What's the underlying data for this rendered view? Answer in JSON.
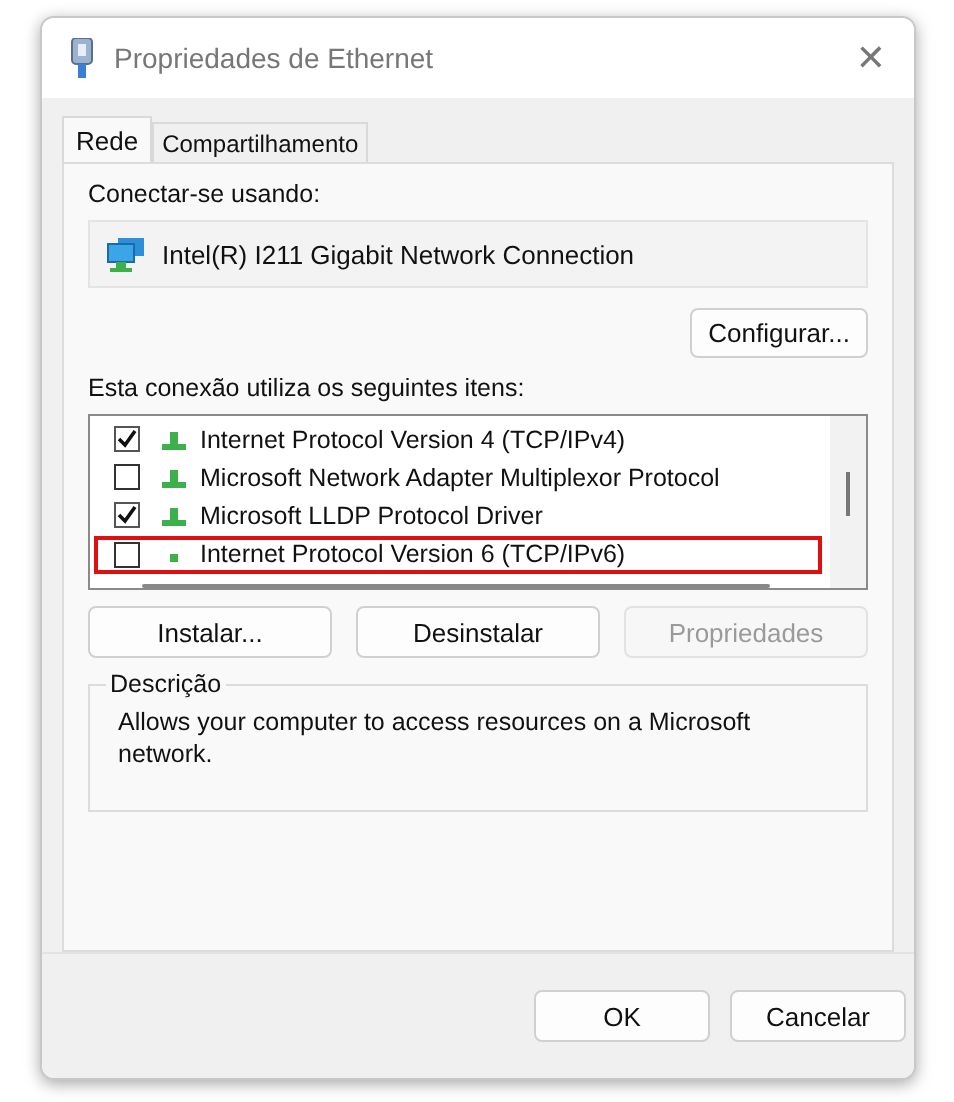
{
  "window": {
    "title": "Propriedades de Ethernet",
    "close": "✕"
  },
  "tabs": [
    {
      "label": "Rede",
      "selected": true
    },
    {
      "label": "Compartilhamento",
      "selected": false
    }
  ],
  "connect_label": "Conectar-se usando:",
  "adapter": "Intel(R) I211 Gigabit Network Connection",
  "configure_button": "Configurar...",
  "items_label": "Esta conexão utiliza os seguintes itens:",
  "items": [
    {
      "label": "Internet Protocol Version 4 (TCP/IPv4)",
      "checked": true,
      "highlighted": false
    },
    {
      "label": "Microsoft Network Adapter Multiplexor Protocol",
      "checked": false,
      "highlighted": false
    },
    {
      "label": "Microsoft LLDP Protocol Driver",
      "checked": true,
      "highlighted": false
    },
    {
      "label": "Internet Protocol Version 6 (TCP/IPv6)",
      "checked": false,
      "highlighted": true
    }
  ],
  "item_buttons": [
    {
      "label": "Instalar...",
      "disabled": false
    },
    {
      "label": "Desinstalar",
      "disabled": false
    },
    {
      "label": "Propriedades",
      "disabled": true
    }
  ],
  "description": {
    "title": "Descrição",
    "text": "Allows your computer to access resources on a Microsoft network."
  },
  "footer_buttons": [
    "OK",
    "Cancelar"
  ]
}
